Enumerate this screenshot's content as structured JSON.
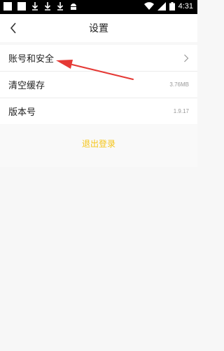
{
  "status_bar": {
    "time": "4:31"
  },
  "header": {
    "title": "设置"
  },
  "settings": [
    {
      "label": "账号和安全",
      "value": ""
    },
    {
      "label": "清空缓存",
      "value": "3.76MB"
    },
    {
      "label": "版本号",
      "value": "1.9.17"
    }
  ],
  "logout_label": "退出登录",
  "colors": {
    "accent": "#f5c518",
    "annotation_arrow": "#e53935"
  }
}
